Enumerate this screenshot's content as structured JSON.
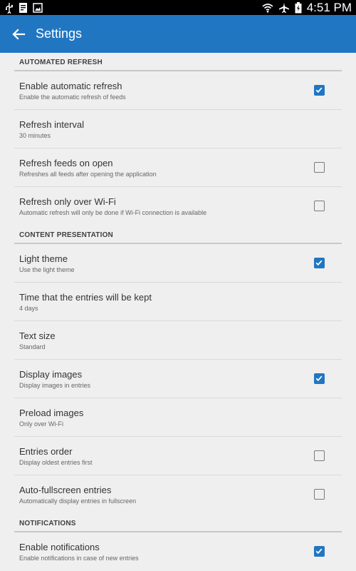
{
  "status_bar": {
    "time": "4:51 PM",
    "left_icons": [
      "usb-icon",
      "notification-icon",
      "image-icon"
    ],
    "right_icons": [
      "wifi-icon",
      "airplane-icon",
      "battery-icon"
    ]
  },
  "app_bar": {
    "title": "Settings",
    "back_icon": "back-arrow-icon",
    "color": "#2176c2"
  },
  "sections": [
    {
      "header": "AUTOMATED REFRESH",
      "items": [
        {
          "title": "Enable automatic refresh",
          "summary": "Enable the automatic refresh of feeds",
          "checkbox": true,
          "checked": true
        },
        {
          "title": "Refresh interval",
          "summary": "30 minutes",
          "checkbox": false
        },
        {
          "title": "Refresh feeds on open",
          "summary": "Refreshes all feeds after opening the application",
          "checkbox": true,
          "checked": false
        },
        {
          "title": "Refresh only over Wi-Fi",
          "summary": "Automatic refresh will only be done if Wi-Fi connection is available",
          "checkbox": true,
          "checked": false
        }
      ]
    },
    {
      "header": "CONTENT PRESENTATION",
      "items": [
        {
          "title": "Light theme",
          "summary": "Use the light theme",
          "checkbox": true,
          "checked": true
        },
        {
          "title": "Time that the entries will be kept",
          "summary": "4 days",
          "checkbox": false
        },
        {
          "title": "Text size",
          "summary": "Standard",
          "checkbox": false
        },
        {
          "title": "Display images",
          "summary": "Display images in entries",
          "checkbox": true,
          "checked": true
        },
        {
          "title": "Preload images",
          "summary": "Only over Wi-Fi",
          "checkbox": false
        },
        {
          "title": "Entries order",
          "summary": "Display oldest entries first",
          "checkbox": true,
          "checked": false
        },
        {
          "title": "Auto-fullscreen entries",
          "summary": "Automatically display entries in fullscreen",
          "checkbox": true,
          "checked": false
        }
      ]
    },
    {
      "header": "NOTIFICATIONS",
      "items": [
        {
          "title": "Enable notifications",
          "summary": "Enable notifications in case of new entries",
          "checkbox": true,
          "checked": true
        }
      ]
    }
  ]
}
